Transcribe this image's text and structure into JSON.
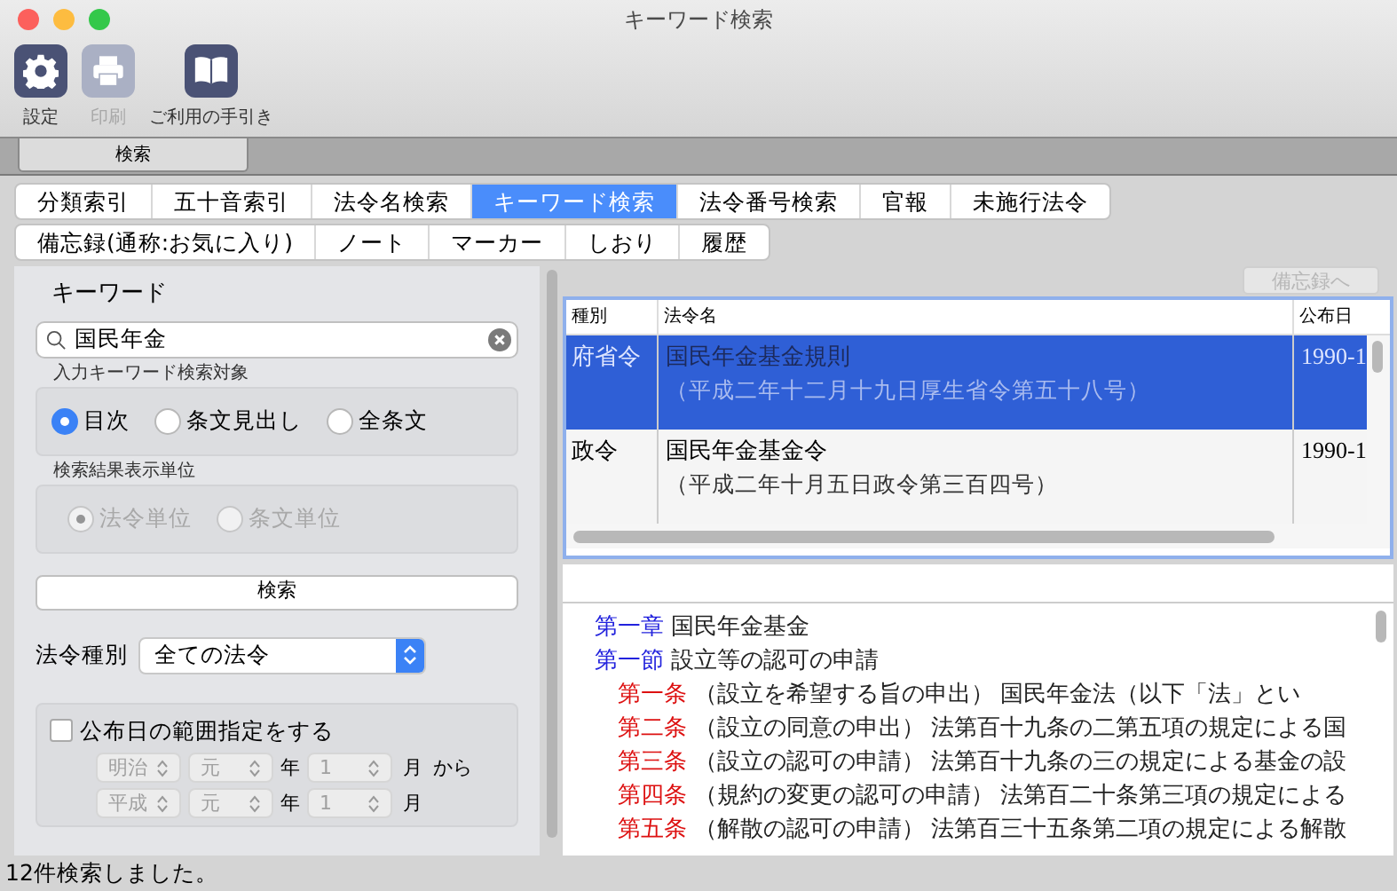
{
  "window": {
    "title": "キーワード検索"
  },
  "toolbar": [
    {
      "kind": "gear",
      "label": "設定",
      "disabled": false
    },
    {
      "kind": "printer",
      "label": "印刷",
      "disabled": true
    },
    {
      "kind": "book",
      "label": "ご利用の手引き",
      "disabled": false
    }
  ],
  "main_tabs": [
    {
      "label": "検索",
      "selected": true
    }
  ],
  "search_modes": [
    {
      "label": "分類索引",
      "selected": false
    },
    {
      "label": "五十音索引",
      "selected": false
    },
    {
      "label": "法令名検索",
      "selected": false
    },
    {
      "label": "キーワード検索",
      "selected": true
    },
    {
      "label": "法令番号検索",
      "selected": false
    },
    {
      "label": "官報",
      "selected": false
    },
    {
      "label": "未施行法令",
      "selected": false
    }
  ],
  "list_modes": [
    {
      "label": "備忘録(通称:お気に入り)",
      "selected": false
    },
    {
      "label": "ノート",
      "selected": false
    },
    {
      "label": "マーカー",
      "selected": false
    },
    {
      "label": "しおり",
      "selected": false
    },
    {
      "label": "履歴",
      "selected": false
    }
  ],
  "keyword_panel": {
    "heading": "キーワード",
    "search_value": "国民年金",
    "target": {
      "label": "入力キーワード検索対象",
      "disabled": false,
      "options": [
        {
          "label": "目次",
          "selected": true
        },
        {
          "label": "条文見出し",
          "selected": false
        },
        {
          "label": "全条文",
          "selected": false
        }
      ]
    },
    "unit": {
      "label": "検索結果表示単位",
      "disabled": true,
      "options": [
        {
          "label": "法令単位",
          "selected": true
        },
        {
          "label": "条文単位",
          "selected": false
        }
      ]
    },
    "search_button": "検索",
    "law_type": {
      "label": "法令種別",
      "value": "全ての法令"
    },
    "date_range": {
      "label": "公布日の範囲指定をする",
      "checked": false,
      "rows": [
        {
          "era": "明治",
          "year": "元",
          "year_unit": "年",
          "month": "1",
          "month_unit": "月",
          "suffix": "から"
        },
        {
          "era": "平成",
          "year": "元",
          "year_unit": "年",
          "month": "1",
          "month_unit": "月"
        }
      ]
    }
  },
  "memo_button": {
    "label": "備忘録へ",
    "disabled": true
  },
  "results": {
    "columns": [
      "種別",
      "法令名",
      "公布日"
    ],
    "rows": [
      {
        "type": "府省令",
        "name": "国民年金基金規則",
        "number": "（平成二年十二月十九日厚生省令第五十八号）",
        "date": "1990-1",
        "selected": true
      },
      {
        "type": "政令",
        "name": "国民年金基金令",
        "number": "（平成二年十月五日政令第三百四号）",
        "date": "1990-1",
        "selected": false
      }
    ]
  },
  "contents": [
    {
      "kind": "chapter",
      "label": "第一章",
      "text": "国民年金基金"
    },
    {
      "kind": "chapter",
      "label": "第一節",
      "text": "設立等の認可の申請"
    },
    {
      "kind": "article",
      "label": "第一条",
      "text": "（設立を希望する旨の申出）  国民年金法（以下「法」とい"
    },
    {
      "kind": "article",
      "label": "第二条",
      "text": "（設立の同意の申出）  法第百十九条の二第五項の規定による国"
    },
    {
      "kind": "article",
      "label": "第三条",
      "text": "（設立の認可の申請）  法第百十九条の三の規定による基金の設"
    },
    {
      "kind": "article",
      "label": "第四条",
      "text": "（規約の変更の認可の申請）  法第百二十条第三項の規定による"
    },
    {
      "kind": "article",
      "label": "第五条",
      "text": "（解散の認可の申請）  法第百三十五条第二項の規定による解散"
    }
  ],
  "status_bar": "12件検索しました。"
}
